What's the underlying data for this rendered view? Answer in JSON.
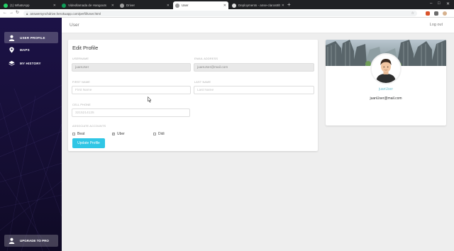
{
  "browser": {
    "tabs": [
      {
        "title": "(1) WhatsApp",
        "color": "#25d366"
      },
      {
        "title": "Videollamada de Hangouts",
        "color": "#0f9d58"
      },
      {
        "title": "Driver",
        "color": "#9e9e9e"
      },
      {
        "title": "User",
        "color": "#9e9e9e"
      },
      {
        "title": "Deployments - anse-claros8/5pro",
        "color": "#e0e0e0"
      }
    ],
    "url": "answersynchdrive.herokuapp.com/perfil/User.html"
  },
  "sidebar": {
    "items": [
      {
        "label": "USER PROFILE",
        "icon": "user-icon"
      },
      {
        "label": "MAPS",
        "icon": "map-pin-icon"
      },
      {
        "label": "MY HISTORY",
        "icon": "layers-icon"
      }
    ],
    "upgrade_label": "UPGRADE TO PRO"
  },
  "topbar": {
    "title": "User",
    "logout_label": "Log out"
  },
  "edit_profile": {
    "title": "Edit Profile",
    "username_label": "USERNAME",
    "username_value": "juanUser",
    "email_label": "EMAIL ADDRESS",
    "email_value": "juanUser@mail.com",
    "first_name_label": "FIRST NAME",
    "first_name_placeholder": "First Name",
    "last_name_label": "LAST NAME",
    "last_name_placeholder": "Last Name",
    "cell_phone_label": "CELL PHONE",
    "cell_phone_placeholder": "3215214125",
    "associate_label": "ASSOCIATE ACCOUNTS",
    "accounts": [
      {
        "label": "Beat",
        "checked": false
      },
      {
        "label": "Uber",
        "checked": true
      },
      {
        "label": "Didi",
        "checked": false
      }
    ],
    "update_button": "Update Profile"
  },
  "profile_card": {
    "username": "juanUser",
    "email": "juanUser@mail.com"
  }
}
